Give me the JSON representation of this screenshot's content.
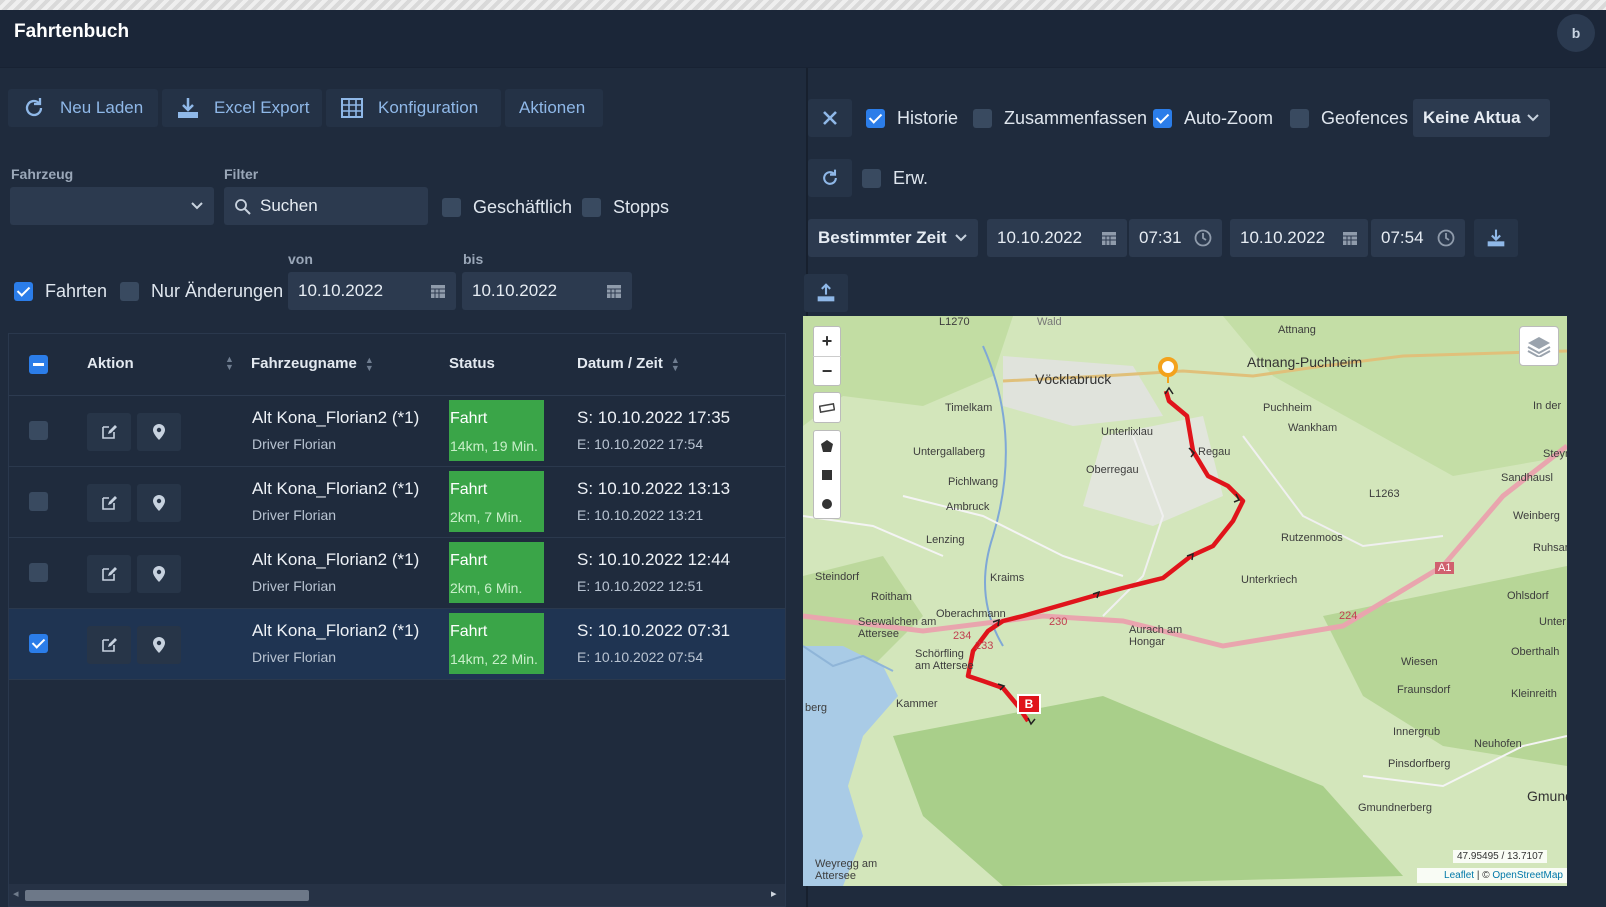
{
  "app": {
    "title": "Fahrtenbuch",
    "avatar": "b"
  },
  "toolbar": {
    "reload": "Neu Laden",
    "excel": "Excel Export",
    "config": "Konfiguration",
    "actions": "Aktionen"
  },
  "filters": {
    "vehicle_label": "Fahrzeug",
    "vehicle_value": "",
    "filter_label": "Filter",
    "search_placeholder": "Suchen",
    "business_label": "Geschäftlich",
    "stops_label": "Stopps",
    "trips_label": "Fahrten",
    "changes_label": "Nur Änderungen",
    "from_label": "von",
    "to_label": "bis",
    "from_date": "10.10.2022",
    "to_date": "10.10.2022",
    "trips_checked": true,
    "changes_checked": false,
    "business_checked": false,
    "stops_checked": false
  },
  "table": {
    "headers": {
      "action": "Aktion",
      "vehicle": "Fahrzeugname",
      "status": "Status",
      "datetime": "Datum / Zeit"
    },
    "rows": [
      {
        "name": "Alt Kona_Florian2 (*1)",
        "driver": "Driver Florian",
        "status": "Fahrt",
        "detail": "14km, 19 Min.",
        "start": "S: 10.10.2022 17:35",
        "end": "E: 10.10.2022 17:54",
        "checked": false
      },
      {
        "name": "Alt Kona_Florian2 (*1)",
        "driver": "Driver Florian",
        "status": "Fahrt",
        "detail": "2km, 7 Min.",
        "start": "S: 10.10.2022 13:13",
        "end": "E: 10.10.2022 13:21",
        "checked": false
      },
      {
        "name": "Alt Kona_Florian2 (*1)",
        "driver": "Driver Florian",
        "status": "Fahrt",
        "detail": "2km, 6 Min.",
        "start": "S: 10.10.2022 12:44",
        "end": "E: 10.10.2022 12:51",
        "checked": false
      },
      {
        "name": "Alt Kona_Florian2 (*1)",
        "driver": "Driver Florian",
        "status": "Fahrt",
        "detail": "14km, 22 Min.",
        "start": "S: 10.10.2022 07:31",
        "end": "E: 10.10.2022 07:54",
        "checked": true
      }
    ]
  },
  "mapPanel": {
    "history": "Historie",
    "summarize": "Zusammenfassen",
    "autozoom": "Auto-Zoom",
    "geofences": "Geofences",
    "update_select": "Keine Aktua",
    "extended": "Erw.",
    "time_mode": "Bestimmter Zeit",
    "start_date": "10.10.2022",
    "start_time": "07:31",
    "end_date": "10.10.2022",
    "end_time": "07:54",
    "history_checked": true,
    "summarize_checked": false,
    "autozoom_checked": true,
    "geofences_checked": false,
    "extended_checked": false
  },
  "map": {
    "coords": "47.95495 / 13.7107",
    "attribution_leaflet": "Leaflet",
    "attribution_sep": " | © ",
    "attribution_osm": "OpenStreetMap",
    "marker_end": "B",
    "places": [
      "Vöcklabruck",
      "Attnang-Puchheim",
      "Attnang",
      "Puchheim",
      "Timelkam",
      "Unterlixlau",
      "Wankham",
      "Untergallaberg",
      "Oberregau",
      "Regau",
      "Pichlwang",
      "Ambruck",
      "Lenzing",
      "Rutzenmoos",
      "Steindorf",
      "Kraims",
      "Unterkriech",
      "Roitham",
      "Oberachmann",
      "Seewalchen am Attersee",
      "Aurach am Hongar",
      "Schörfling am Attersee",
      "Kammer",
      "Wiesen",
      "Fraunsdorf",
      "Weinberg",
      "Sandhausl",
      "Ohlsdorf",
      "Oberthalh",
      "Kleinreith",
      "Innergrub",
      "Neuhofen",
      "Pinsdorfberg",
      "Gmundnerberg",
      "Gmund",
      "Weyregg am Attersee",
      "berg",
      "In der",
      "Steyr",
      "Ruhsam",
      "Unter"
    ],
    "road_labels": [
      "L1270",
      "L1263",
      "A1",
      "224",
      "230",
      "233",
      "234",
      "Wald"
    ]
  }
}
